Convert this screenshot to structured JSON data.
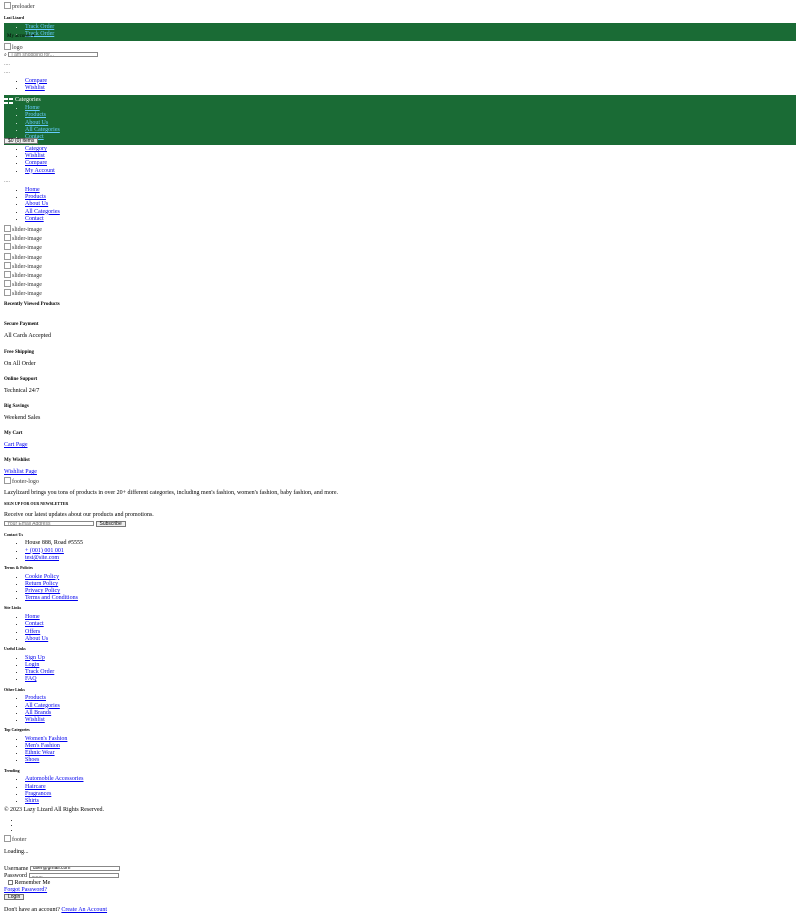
{
  "preloader": {
    "alt": "preloader"
  },
  "site": {
    "name": "Lazi Lizard"
  },
  "top_links": [
    "Track Order",
    "Track Order"
  ],
  "account": {
    "label": "My account ▾"
  },
  "logo": {
    "alt": "logo"
  },
  "search": {
    "placeholder": "I am shopping for..."
  },
  "dots1": "....",
  "dots2": "....",
  "header_links": [
    "Compare",
    "Wishlist"
  ],
  "categories": {
    "title": "Categories"
  },
  "main_nav": [
    "Home",
    "Products",
    "About Us",
    "All Categories",
    "Contact"
  ],
  "cart_button": "$0 (0) items",
  "account_menu": [
    "Category",
    "Wishlist",
    "Compare",
    "My Account"
  ],
  "dots3": "....",
  "mobile_nav": [
    "Home",
    "Products",
    "About Us",
    "All Categories",
    "Contact"
  ],
  "slider_alts": [
    "slider-image",
    "slider-image",
    "slider-image",
    "slider-image",
    "slider-image",
    "slider-image",
    "slider-image",
    "slider-image"
  ],
  "recently_viewed": "Recently Viewed Products",
  "features": [
    {
      "title": "Secure Payment",
      "desc": "All Cards Accepted"
    },
    {
      "title": "Free Shipping",
      "desc": "On All Order"
    },
    {
      "title": "Online Support",
      "desc": "Technical 24/7"
    },
    {
      "title": "Big Savings",
      "desc": "Weekend Sales"
    },
    {
      "title": "My Cart",
      "desc": "Cart Page"
    },
    {
      "title": "My Wishlist",
      "desc": "Wishlist Page"
    }
  ],
  "footer_logo": {
    "alt": "footer-logo"
  },
  "footer_about": "Lazylizard brings you tons of products in over 20+ different categories, including men's fashion, women's fashion, baby fashion, and more.",
  "newsletter": {
    "title": "SIGN UP FOR OUR NEWSLETTER",
    "desc": "Receive our latest updates about our products and promotions.",
    "placeholder": "Your Email Address",
    "button": "Subscribe"
  },
  "contact": {
    "title": "Contact Us",
    "items": [
      "House 888, Road #5555",
      "+ (001) 001 001",
      "test@site.com"
    ]
  },
  "terms": {
    "title": "Terms & Policies",
    "items": [
      "Cookie Policy",
      "Return Policy",
      "Privacy Policy",
      "Terms and Conditions"
    ]
  },
  "site_links": {
    "title": "Site Links",
    "items": [
      "Home",
      "Contact",
      "Offers",
      "About Us"
    ]
  },
  "useful_links": {
    "title": "Useful Links",
    "items": [
      "Sign Up",
      "Login",
      "Track Order",
      "FAQ"
    ]
  },
  "other_links": {
    "title": "Other Links",
    "items": [
      "Products",
      "All Categories",
      "All Brands",
      "Wishlist"
    ]
  },
  "top_categories": {
    "title": "Top Categories",
    "items": [
      "Women's Fashion",
      "Men's Fashion",
      "Ethnic Wear",
      "Shoes"
    ]
  },
  "trending": {
    "title": "Trending",
    "items": [
      "Automobile Accessories",
      "Haircare",
      "Fragrances",
      "Shirts"
    ]
  },
  "copyright": "© 2023 Lazy Lizard All Rights Reserved.",
  "footer_img": {
    "alt": "footer"
  },
  "loading": "Loading...",
  "login": {
    "username_label": "Username",
    "username_value": "user@gmail.com",
    "password_label": "Password",
    "password_value": "........",
    "remember": "Remember Me",
    "forgot": "Forgot Password?",
    "button": "Login",
    "no_account": "Don't have an account?",
    "create": "Create An Account"
  }
}
